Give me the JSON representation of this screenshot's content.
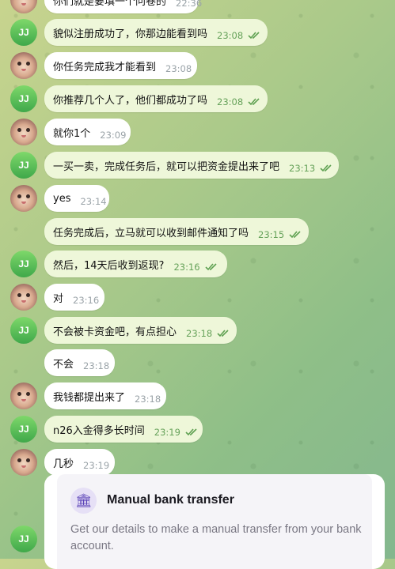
{
  "messages": [
    {
      "side": "in",
      "text": "你们就是要填一个问卷的",
      "time": "22:36",
      "avatar": "cat"
    },
    {
      "side": "out",
      "text": "貌似注册成功了，你那边能看到吗",
      "time": "23:08",
      "avatar": "jj",
      "read": true
    },
    {
      "side": "in",
      "text": "你任务完成我才能看到",
      "time": "23:08",
      "avatar": "cat"
    },
    {
      "side": "out",
      "text": "你推荐几个人了，他们都成功了吗",
      "time": "23:08",
      "avatar": "jj",
      "read": true
    },
    {
      "side": "in",
      "text": "就你1个",
      "time": "23:09",
      "avatar": "cat"
    },
    {
      "side": "out",
      "text": "一买一卖，完成任务后，就可以把资金提出来了吧",
      "time": "23:13",
      "avatar": "jj",
      "read": true
    },
    {
      "side": "in",
      "text": "yes",
      "time": "23:14",
      "avatar": "cat"
    },
    {
      "side": "out",
      "text": "任务完成后，立马就可以收到邮件通知了吗",
      "time": "23:15",
      "avatar": "",
      "read": true
    },
    {
      "side": "out",
      "text": "然后，14天后收到返现?",
      "time": "23:16",
      "avatar": "jj",
      "read": true
    },
    {
      "side": "in",
      "text": "对",
      "time": "23:16",
      "avatar": "cat"
    },
    {
      "side": "out",
      "text": "不会被卡资金吧，有点担心",
      "time": "23:18",
      "avatar": "jj",
      "read": true
    },
    {
      "side": "in",
      "text": "不会",
      "time": "23:18",
      "avatar": ""
    },
    {
      "side": "in",
      "text": "我钱都提出来了",
      "time": "23:18",
      "avatar": "cat"
    },
    {
      "side": "out",
      "text": "n26入金得多长时间",
      "time": "23:19",
      "avatar": "jj",
      "read": true
    },
    {
      "side": "in",
      "text": "几秒",
      "time": "23:19",
      "avatar": "cat"
    }
  ],
  "avatar_initials": "JJ",
  "card": {
    "title": "Manual bank transfer",
    "description": "Get our details to make a manual transfer from your bank account.",
    "icon": "bank-icon"
  },
  "colors": {
    "outgoing_bubble": "#eef7d9",
    "incoming_bubble": "#ffffff",
    "read_ticks": "#5fa152",
    "avatar_green": "#4caf50"
  }
}
